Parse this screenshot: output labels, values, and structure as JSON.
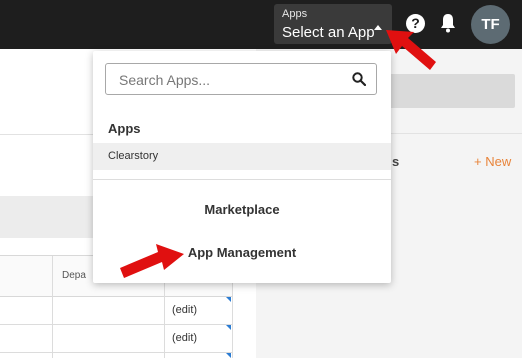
{
  "header": {
    "app_selector": {
      "label": "Apps",
      "value": "Select an App"
    },
    "help_icon": "help-icon",
    "notification_icon": "bell-icon",
    "avatar_initials": "TF"
  },
  "dropdown": {
    "search_placeholder": "Search Apps...",
    "apps_heading": "Apps",
    "apps": [
      "Clearstory"
    ],
    "links": [
      "Marketplace",
      "App Management"
    ]
  },
  "background": {
    "right_panel_partial_heading": "s",
    "new_link": "+ New",
    "table": {
      "partial_column_header": "Depa",
      "rows": [
        {
          "action": "(edit)"
        },
        {
          "action": "(edit)"
        }
      ]
    }
  },
  "annotations": {
    "arrow_color": "#e01010"
  }
}
